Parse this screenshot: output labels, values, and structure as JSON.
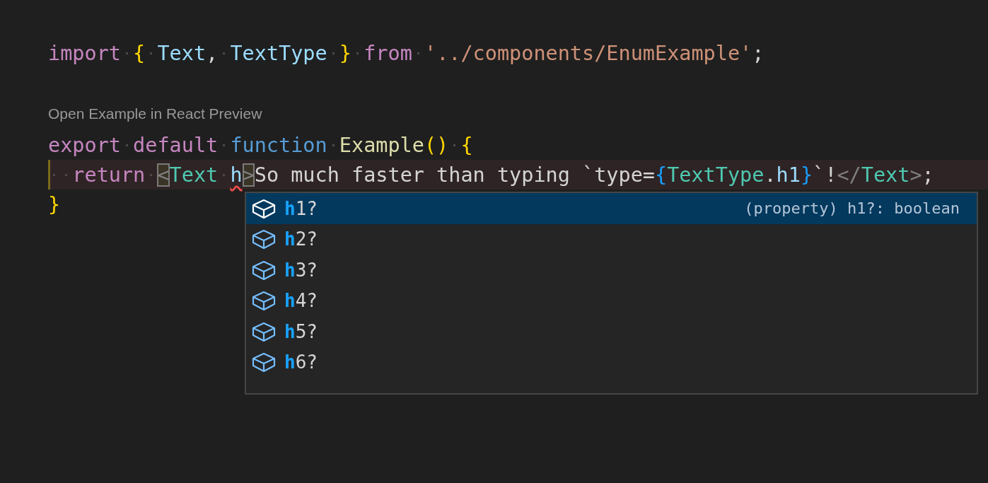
{
  "editor": {
    "lines": [
      {
        "kind": "code",
        "tokens": [
          {
            "kind": "keyword",
            "text": "import"
          },
          {
            "kind": "space"
          },
          {
            "kind": "brace",
            "text": "{"
          },
          {
            "kind": "space"
          },
          {
            "kind": "variable",
            "text": "Text"
          },
          {
            "kind": "plain",
            "text": ","
          },
          {
            "kind": "space"
          },
          {
            "kind": "variable",
            "text": "TextType"
          },
          {
            "kind": "space"
          },
          {
            "kind": "brace",
            "text": "}"
          },
          {
            "kind": "space"
          },
          {
            "kind": "keyword",
            "text": "from"
          },
          {
            "kind": "space"
          },
          {
            "kind": "string",
            "text": "'../components/EnumExample'"
          },
          {
            "kind": "plain",
            "text": ";"
          }
        ]
      },
      {
        "kind": "blank"
      },
      {
        "kind": "codelens",
        "text": "Open Example in React Preview"
      },
      {
        "kind": "code",
        "tokens": [
          {
            "kind": "keyword",
            "text": "export"
          },
          {
            "kind": "space"
          },
          {
            "kind": "keyword",
            "text": "default"
          },
          {
            "kind": "space"
          },
          {
            "kind": "storage",
            "text": "function"
          },
          {
            "kind": "space"
          },
          {
            "kind": "func",
            "text": "Example"
          },
          {
            "kind": "brace",
            "text": "()"
          },
          {
            "kind": "space"
          },
          {
            "kind": "brace",
            "text": "{"
          }
        ]
      },
      {
        "kind": "current",
        "tokens": [
          {
            "kind": "space"
          },
          {
            "kind": "space"
          },
          {
            "kind": "keyword",
            "text": "return"
          },
          {
            "kind": "space"
          },
          {
            "kind": "matched-bracket",
            "text": "<"
          },
          {
            "kind": "tag",
            "text": "Text"
          },
          {
            "kind": "space"
          },
          {
            "kind": "error",
            "text": "h"
          },
          {
            "kind": "matched-bracket",
            "text": ">"
          },
          {
            "kind": "plain",
            "text": "So much faster than typing `type="
          },
          {
            "kind": "blue-brace",
            "text": "{"
          },
          {
            "kind": "tag",
            "text": "TextType"
          },
          {
            "kind": "plain",
            "text": "."
          },
          {
            "kind": "variable",
            "text": "h1"
          },
          {
            "kind": "blue-brace",
            "text": "}"
          },
          {
            "kind": "plain",
            "text": "`!"
          },
          {
            "kind": "punct",
            "text": "</"
          },
          {
            "kind": "tag",
            "text": "Text"
          },
          {
            "kind": "punct",
            "text": ">"
          },
          {
            "kind": "plain",
            "text": ";"
          }
        ]
      },
      {
        "kind": "code",
        "tokens": [
          {
            "kind": "brace",
            "text": "}"
          }
        ]
      }
    ]
  },
  "suggestions": [
    {
      "match": "h",
      "rest": "1?",
      "selected": true,
      "detail": "(property) h1?: boolean"
    },
    {
      "match": "h",
      "rest": "2?",
      "selected": false
    },
    {
      "match": "h",
      "rest": "3?",
      "selected": false
    },
    {
      "match": "h",
      "rest": "4?",
      "selected": false
    },
    {
      "match": "h",
      "rest": "5?",
      "selected": false
    },
    {
      "match": "h",
      "rest": "6?",
      "selected": false
    }
  ]
}
